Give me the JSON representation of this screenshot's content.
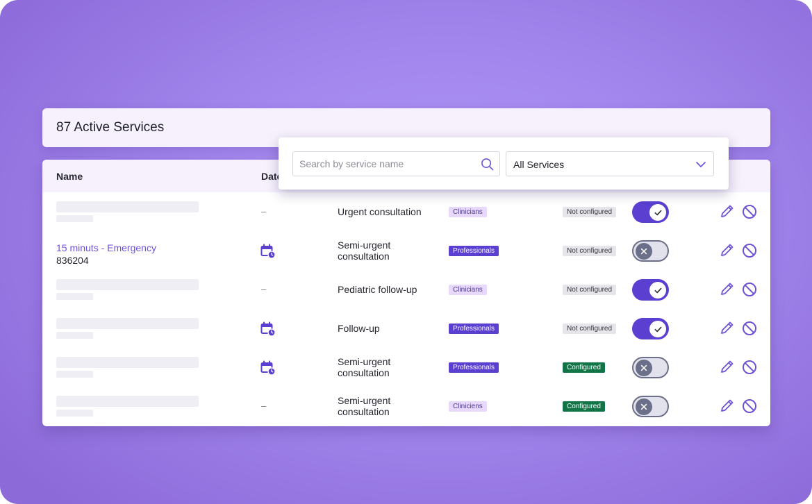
{
  "header": {
    "title": "87 Active Services"
  },
  "table": {
    "columns": [
      "Name",
      "Date"
    ],
    "rows": [
      {
        "name": null,
        "id": null,
        "date_icon": false,
        "service": "Urgent consultation",
        "audience": "Clinicians",
        "audience_style": "light",
        "config": "Not configured",
        "config_style": "not",
        "active": true
      },
      {
        "name": "15 minuts - Emergency",
        "id": "836204",
        "date_icon": true,
        "service": "Semi-urgent consultation",
        "audience": "Professionals",
        "audience_style": "dark",
        "config": "Not configured",
        "config_style": "not",
        "active": false
      },
      {
        "name": null,
        "id": null,
        "date_icon": false,
        "service": "Pediatric follow-up",
        "audience": "Clinicians",
        "audience_style": "light",
        "config": "Not configured",
        "config_style": "not",
        "active": true
      },
      {
        "name": null,
        "id": null,
        "date_icon": true,
        "service": "Follow-up",
        "audience": "Professionals",
        "audience_style": "dark",
        "config": "Not configured",
        "config_style": "not",
        "active": true
      },
      {
        "name": null,
        "id": null,
        "date_icon": true,
        "service": "Semi-urgent consultation",
        "audience": "Professionals",
        "audience_style": "dark",
        "config": "Configured",
        "config_style": "yes",
        "active": false
      },
      {
        "name": null,
        "id": null,
        "date_icon": false,
        "service": "Semi-urgent consultation",
        "audience": "Cliniciens",
        "audience_style": "light",
        "config": "Configured",
        "config_style": "yes",
        "active": false
      }
    ],
    "empty_date": "–"
  },
  "filters": {
    "search_placeholder": "Search by service name",
    "select_value": "All Services"
  },
  "icons": {
    "date": "calendar-clock-icon",
    "edit": "pencil-icon",
    "disable": "block-icon",
    "search": "search-icon",
    "select": "chevron-down-icon",
    "toggle_on": "check-icon",
    "toggle_off": "x-icon"
  },
  "colors": {
    "accent": "#5a3fd1",
    "link": "#6e52d6",
    "configured": "#137447",
    "not_configured": "#e6e6ea",
    "badge_light": "#e8d8fb"
  }
}
